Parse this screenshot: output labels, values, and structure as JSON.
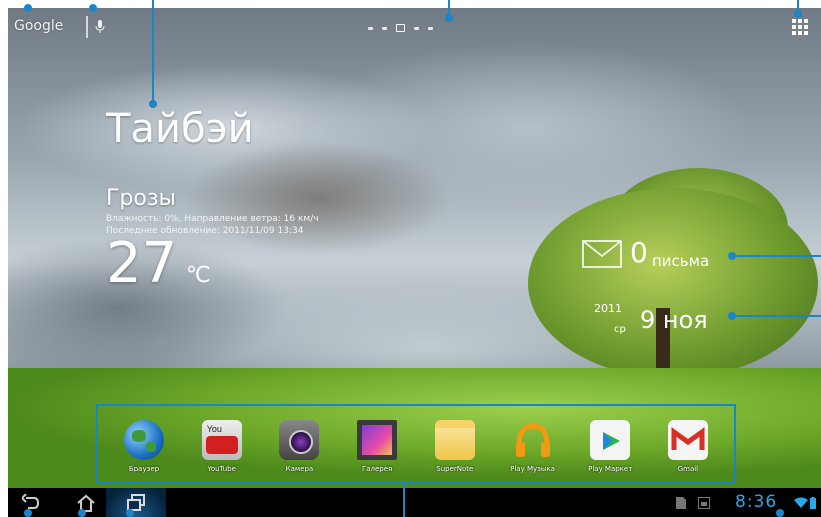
{
  "topbar": {
    "search_label": "Google"
  },
  "weather": {
    "city": "Тайбэй",
    "condition": "Грозы",
    "detail_line1": "Влажность: 0%, Направление ветра: 16 км/ч",
    "detail_line2": "Последнее обновление: 2011/11/09 13:34",
    "temperature": "27",
    "unit": "℃"
  },
  "mail": {
    "count": "0",
    "label": "письма"
  },
  "date": {
    "year": "2011",
    "weekday": "ср",
    "day_month": "9 ноя"
  },
  "dock": {
    "items": [
      {
        "label": "Браузер",
        "icon": "globe-icon"
      },
      {
        "label": "YouTube",
        "icon": "youtube-icon"
      },
      {
        "label": "Камера",
        "icon": "camera-icon"
      },
      {
        "label": "Галерея",
        "icon": "gallery-icon"
      },
      {
        "label": "SuperNote",
        "icon": "notepad-icon"
      },
      {
        "label": "Play Музыка",
        "icon": "headphones-icon"
      },
      {
        "label": "Play Маркет",
        "icon": "play-store-icon"
      },
      {
        "label": "Gmail",
        "icon": "gmail-icon"
      }
    ]
  },
  "youtube_text": "You\nTube",
  "statusbar": {
    "time": "8:36"
  },
  "colors": {
    "callout": "#1a86c8",
    "clock": "#2aa7e8"
  }
}
